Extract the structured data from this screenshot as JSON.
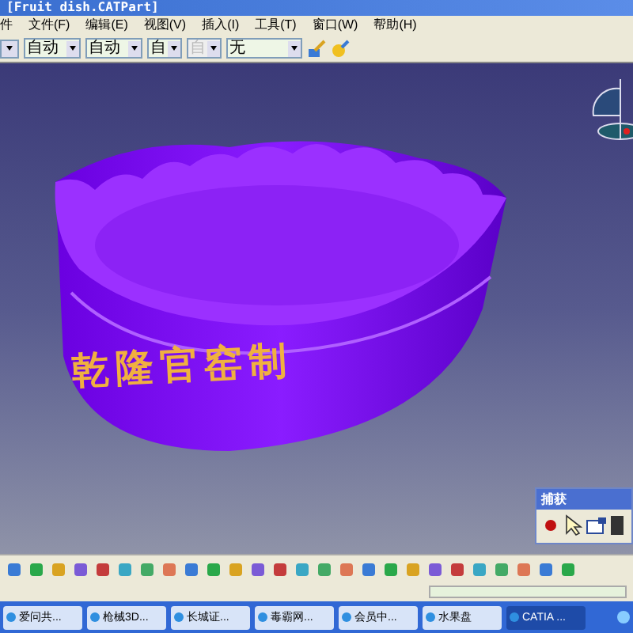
{
  "window": {
    "title": "[Fruit dish.CATPart]"
  },
  "menu": [
    {
      "label": "文件(F)"
    },
    {
      "label": "编辑(E)"
    },
    {
      "label": "视图(V)"
    },
    {
      "label": "插入(I)"
    },
    {
      "label": "工具(T)"
    },
    {
      "label": "窗口(W)"
    },
    {
      "label": "帮助(H)"
    }
  ],
  "menu_prefix": "件",
  "toolbar": {
    "dropdowns": [
      {
        "value": "自动",
        "disabled": false
      },
      {
        "value": "自动",
        "disabled": false
      },
      {
        "value": "自",
        "disabled": false
      },
      {
        "value": "自",
        "disabled": true
      },
      {
        "value": "无",
        "disabled": false
      }
    ]
  },
  "model": {
    "engraving": "乾隆官窑制"
  },
  "capture_panel": {
    "title": "捕获"
  },
  "taskbar": {
    "items": [
      {
        "label": "爱问共...",
        "selected": false
      },
      {
        "label": "枪械3D...",
        "selected": false
      },
      {
        "label": "长城证...",
        "selected": false
      },
      {
        "label": "毒霸网...",
        "selected": false
      },
      {
        "label": "会员中...",
        "selected": false
      },
      {
        "label": "水果盘",
        "selected": false
      },
      {
        "label": "CATIA ...",
        "selected": true
      }
    ]
  }
}
